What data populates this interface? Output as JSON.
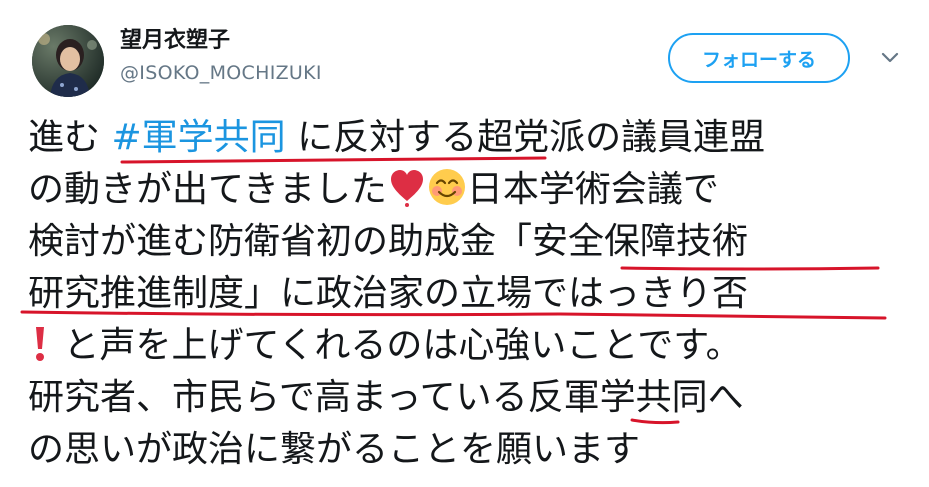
{
  "user": {
    "display_name": "望月衣塑子",
    "handle": "@ISOKO_MOCHIZUKI"
  },
  "actions": {
    "follow_label": "フォローする"
  },
  "tweet": {
    "lines": [
      {
        "pre": "進む ",
        "hashtag": "#軍学共同",
        "post": " に反対する超党派の議員連盟"
      },
      {
        "text": "の動きが出てきました",
        "after_emoji": "日本学術会議で"
      },
      {
        "text": "検討が進む防衛省初の助成金「安全保障技術"
      },
      {
        "text": "研究推進制度」に政治家の立場ではっきり否"
      },
      {
        "text": " と声を上げてくれるのは心強いことです。"
      },
      {
        "text": "研究者、市民らで高まっている反軍学共同へ"
      },
      {
        "text": "の思いが政治に繋がることを願います"
      }
    ]
  },
  "emojis": [
    "heavy-exclamation-icon",
    "smiling-face-icon"
  ],
  "colors": {
    "accent": "#1da1f2",
    "hashtag": "#1b95e0",
    "annotation_underline": "#d7142a",
    "handle_gray": "#657786"
  }
}
